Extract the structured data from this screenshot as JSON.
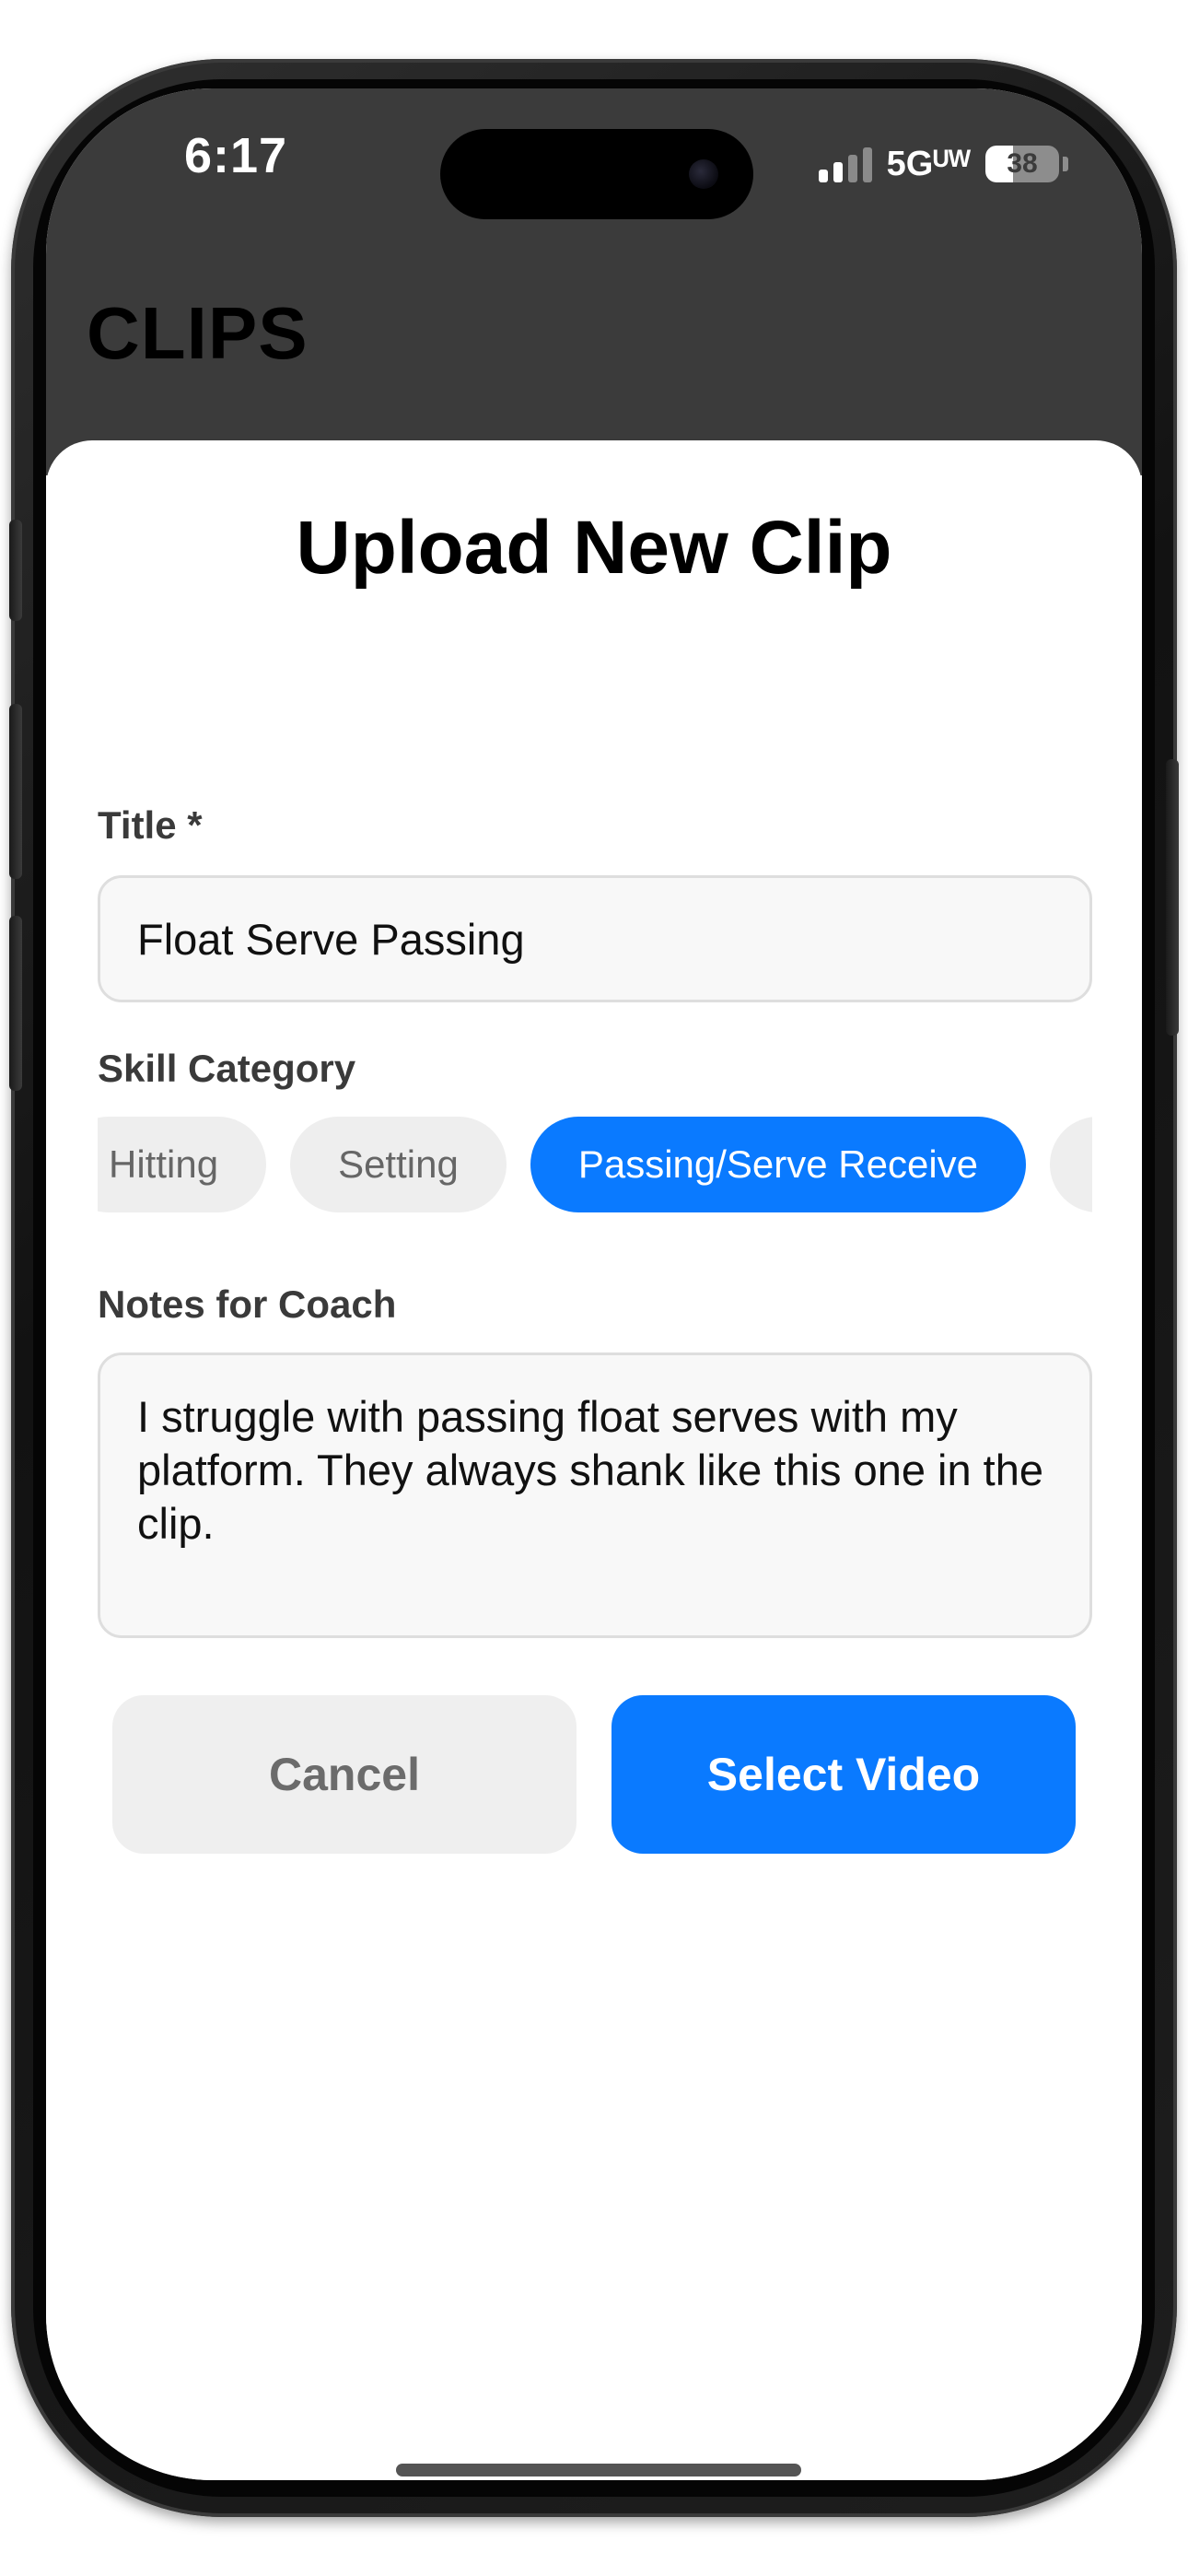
{
  "status_bar": {
    "time": "6:17",
    "network": "5Gᵁᵂ",
    "battery_level": "38",
    "battery_fraction": 0.38
  },
  "header": {
    "app_title": "CLIPS"
  },
  "sheet": {
    "title": "Upload New Clip",
    "title_field": {
      "label": "Title *",
      "value": "Float Serve Passing"
    },
    "skill_category": {
      "label": "Skill Category",
      "options": [
        "Hitting",
        "Setting",
        "Passing/Serve Receive",
        ""
      ],
      "selected": "Passing/Serve Receive"
    },
    "notes_field": {
      "label": "Notes for Coach",
      "value": "I struggle with passing float serves with my platform. They always shank like this one in the clip."
    },
    "buttons": {
      "cancel_label": "Cancel",
      "select_label": "Select Video"
    }
  },
  "colors": {
    "accent": "#0a7aff",
    "header_bg": "#3b3b3b",
    "chip_bg": "#eeeeee"
  }
}
